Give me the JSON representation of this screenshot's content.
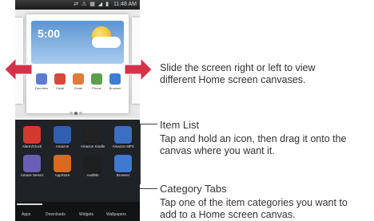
{
  "phone": {
    "status_time": "11:48 AM",
    "status_icons": "⇄ ⚠ ▦ ◢ ▮",
    "weather_time": "5:00",
    "home_icons": [
      {
        "label": "Favorites",
        "color": "#5e7bd1"
      },
      {
        "label": "Gmail",
        "color": "#d64a3b"
      },
      {
        "label": "Email",
        "color": "#e07b39"
      },
      {
        "label": "Phone",
        "color": "#5b9f4a"
      },
      {
        "label": "Browser",
        "color": "#3b7fd4"
      }
    ],
    "apps_row1": [
      {
        "label": "Alarm/Clock",
        "color": "#d13b2f"
      },
      {
        "label": "Amazon",
        "color": "#2f5fae"
      },
      {
        "label": "Amazon Kindle",
        "color": "#222222"
      },
      {
        "label": "Amazon MP3",
        "color": "#3a6fc2"
      }
    ],
    "apps_row2": [
      {
        "label": "Amaze Server",
        "color": "#6b5fb5"
      },
      {
        "label": "AppStore",
        "color": "#d96a1e"
      },
      {
        "label": "Audible",
        "color": "#1f1f1f"
      },
      {
        "label": "Browser",
        "color": "#3f79d0"
      }
    ],
    "tabs": [
      "Apps",
      "Downloads",
      "Widgets",
      "Wallpapers"
    ]
  },
  "annotations": {
    "canvases_text": [
      "Slide the screen right or left to view",
      "different Home screen canvases."
    ],
    "item_list_title": "Item List",
    "item_list_text": [
      "Tap and hold an icon, then drag it onto the",
      "canvas where you want it."
    ],
    "category_tabs_title": "Category Tabs",
    "category_tabs_text": [
      "Tap one of the item categories you want to",
      "add to a Home screen canvas."
    ]
  },
  "colors": {
    "arrow": "#d3334a",
    "annotation_text": "#333333"
  }
}
